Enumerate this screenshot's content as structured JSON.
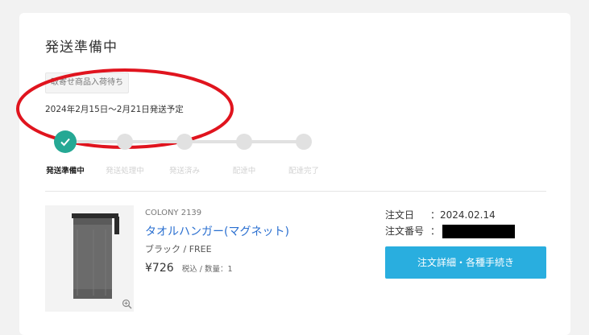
{
  "status": {
    "title": "発送準備中",
    "badge": "取寄せ商品入荷待ち",
    "ship_date": "2024年2月15日～2月21日発送予定"
  },
  "progress": {
    "steps": [
      "発送準備中",
      "発送処理中",
      "発送済み",
      "配達中",
      "配達完了"
    ],
    "current_step": 1
  },
  "item": {
    "brand": "COLONY 2139",
    "name": "タオルハンガー(マグネット)",
    "variant": "ブラック / FREE",
    "price": "¥726",
    "price_note": "税込 / 数量：1",
    "zoom_icon": "zoom-in-icon"
  },
  "order": {
    "date_label": "注文日",
    "date_value": "：2024.02.14",
    "number_label": "注文番号",
    "number_sep": "：",
    "button_label": "注文詳細・各種手続き"
  },
  "colors": {
    "accent_green": "#25a894",
    "button_blue": "#29aedf",
    "link_blue": "#2a6fd0",
    "annotation_red": "#e0141e"
  }
}
